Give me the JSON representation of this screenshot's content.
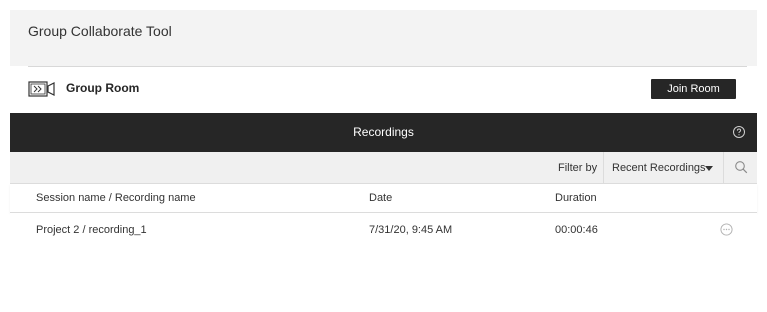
{
  "header": {
    "title": "Group Collaborate Tool"
  },
  "room": {
    "icon": "video-camera-icon",
    "name": "Group Room",
    "join_label": "Join Room"
  },
  "recordings_bar": {
    "title": "Recordings",
    "help_icon": "help-icon"
  },
  "filter": {
    "label": "Filter by",
    "selected": "Recent Recordings",
    "dropdown_icon": "caret-down-icon",
    "search_icon": "search-icon"
  },
  "table": {
    "columns": [
      "Session name / Recording name",
      "Date",
      "Duration"
    ],
    "rows": [
      {
        "name": "Project 2 / recording_1",
        "date": "7/31/20, 9:45 AM",
        "duration": "00:00:46",
        "action_icon": "more-options-icon"
      }
    ]
  },
  "colors": {
    "dark_bar": "#262626",
    "header_bg": "#f3f3f3",
    "filter_bg": "#f0f0f0"
  }
}
